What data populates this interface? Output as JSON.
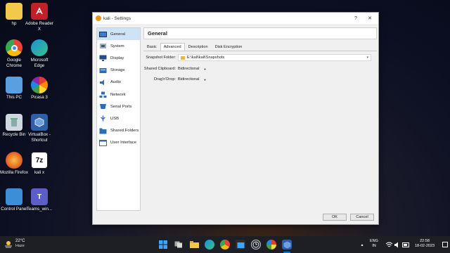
{
  "desktop": {
    "icons": [
      {
        "label": "hp",
        "icon": "folder-icon",
        "color": "#f2c94c"
      },
      {
        "label": "Adobe Reader X",
        "icon": "adobe-reader-icon",
        "color": "#c0202a"
      },
      {
        "label": "Google Chrome",
        "icon": "chrome-icon",
        "color": "#34a853"
      },
      {
        "label": "Microsoft Edge",
        "icon": "edge-icon",
        "color": "#1a8fd6"
      },
      {
        "label": "This PC",
        "icon": "computer-icon",
        "color": "#5aa0e0"
      },
      {
        "label": "Picasa 3",
        "icon": "picasa-icon",
        "color": "#f09a3c"
      },
      {
        "label": "Recycle Bin",
        "icon": "recycle-bin-icon",
        "color": "#cfd8e0"
      },
      {
        "label": "VirtualBox - Shortcut",
        "icon": "virtualbox-icon",
        "color": "#2f5fa8"
      },
      {
        "label": "Mozilla Firefox",
        "icon": "firefox-icon",
        "color": "#e66a1f"
      },
      {
        "label": "kali x",
        "icon": "7zip-icon",
        "color": "#ffffff"
      },
      {
        "label": "Control Panel",
        "icon": "control-panel-icon",
        "color": "#3b8fd6"
      },
      {
        "label": "Teams_win...",
        "icon": "teams-icon",
        "color": "#5b5fc7"
      }
    ]
  },
  "window": {
    "title": "kali - Settings",
    "help": "?",
    "close": "✕",
    "sidebar": [
      {
        "label": "General",
        "icon": "general-icon",
        "active": true
      },
      {
        "label": "System",
        "icon": "system-icon"
      },
      {
        "label": "Display",
        "icon": "display-icon"
      },
      {
        "label": "Storage",
        "icon": "storage-icon"
      },
      {
        "label": "Audio",
        "icon": "audio-icon"
      },
      {
        "label": "Network",
        "icon": "network-icon"
      },
      {
        "label": "Serial Ports",
        "icon": "serial-ports-icon"
      },
      {
        "label": "USB",
        "icon": "usb-icon"
      },
      {
        "label": "Shared Folders",
        "icon": "shared-folders-icon"
      },
      {
        "label": "User Interface",
        "icon": "user-interface-icon"
      }
    ],
    "header": "General",
    "tabs": [
      "Basic",
      "Advanced",
      "Description",
      "Disk Encryption"
    ],
    "active_tab": "Advanced",
    "fields": {
      "snapshot_folder_label": "Snapshot Folder:",
      "snapshot_folder_value": "E:\\kali\\kali\\Snapshots",
      "clipboard_label": "Shared Clipboard:",
      "clipboard_value": "Bidirectional",
      "dnd_label": "Drag'n'Drop:",
      "dnd_value": "Bidirectional"
    },
    "buttons": {
      "ok": "OK",
      "cancel": "Cancel"
    }
  },
  "taskbar": {
    "weather_temp": "22°C",
    "weather_desc": "Haze",
    "language": "ENG",
    "region": "IN",
    "time": "22:58",
    "date": "18-02-2023",
    "accent": "#0078d4"
  }
}
